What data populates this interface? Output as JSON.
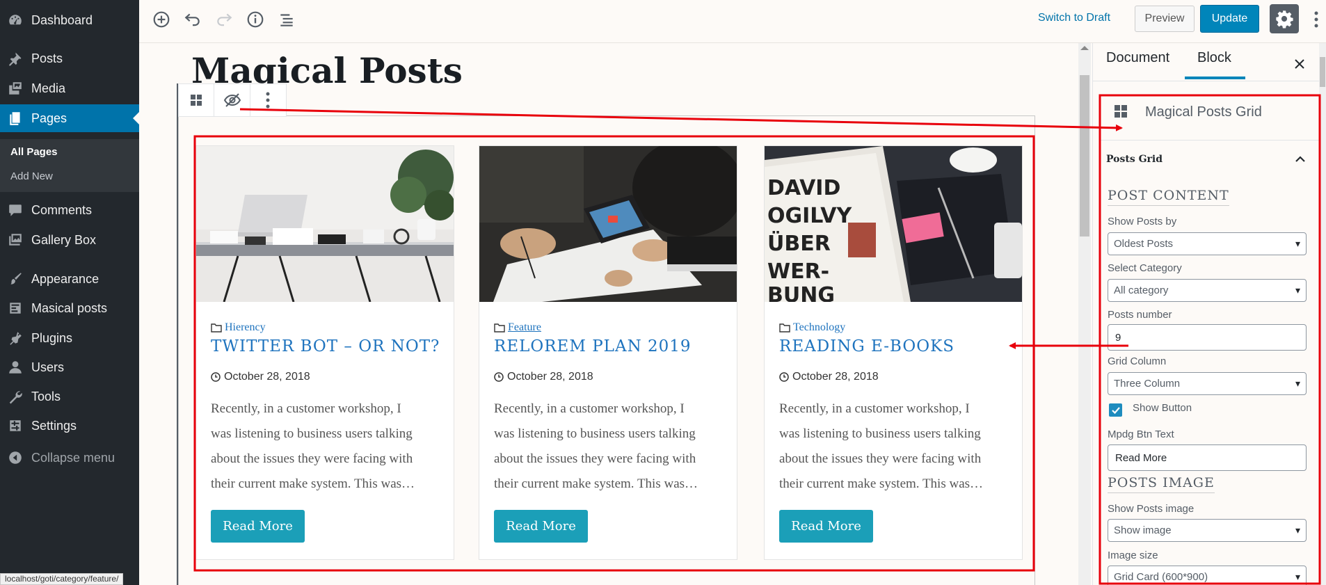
{
  "sidebar": {
    "items": [
      {
        "label": "Dashboard",
        "icon": "dashboard-icon"
      },
      {
        "label": "Posts",
        "icon": "pin-icon"
      },
      {
        "label": "Media",
        "icon": "media-icon"
      },
      {
        "label": "Pages",
        "icon": "pages-icon",
        "active": true
      },
      {
        "label": "Comments",
        "icon": "comment-icon"
      },
      {
        "label": "Gallery Box",
        "icon": "gallery-icon"
      },
      {
        "label": "Appearance",
        "icon": "brush-icon"
      },
      {
        "label": "Masical posts",
        "icon": "posts-icon"
      },
      {
        "label": "Plugins",
        "icon": "plugin-icon"
      },
      {
        "label": "Users",
        "icon": "user-icon"
      },
      {
        "label": "Tools",
        "icon": "wrench-icon"
      },
      {
        "label": "Settings",
        "icon": "settings-icon"
      }
    ],
    "submenu": {
      "all_pages": "All Pages",
      "add_new": "Add New"
    },
    "collapse_label": "Collapse menu"
  },
  "toolbar": {
    "switch_to_draft": "Switch to Draft",
    "preview_label": "Preview",
    "update_label": "Update"
  },
  "editor": {
    "page_title": "Magical Posts",
    "cards": [
      {
        "category": "Hierency",
        "title": "TWITTER BOT – OR NOT?",
        "date": "October 28, 2018",
        "excerpt": [
          "Recently, in a customer workshop, I",
          "was listening to business users talking",
          "about the issues they were facing with",
          "their current make system. This was…"
        ],
        "button": "Read More"
      },
      {
        "category": "Feature",
        "title": "RELOREM PLAN 2019",
        "date": "October 28, 2018",
        "excerpt": [
          "Recently, in a customer workshop, I",
          "was listening to business users talking",
          "about the issues they were facing with",
          "their current make system. This was…"
        ],
        "button": "Read More"
      },
      {
        "category": "Technology",
        "title": "READING E-BOOKS",
        "date": "October 28, 2018",
        "excerpt": [
          "Recently, in a customer workshop, I",
          "was listening to business users talking",
          "about the issues they were facing with",
          "their current make system. This was…"
        ],
        "button": "Read More"
      }
    ]
  },
  "panel": {
    "tabs": {
      "document": "Document",
      "block": "Block"
    },
    "block_name": "Magical Posts Grid",
    "section_title": "Posts Grid",
    "post_content_heading": "POST CONTENT",
    "show_posts_by": {
      "label": "Show Posts by",
      "value": "Oldest Posts"
    },
    "select_category": {
      "label": "Select Category",
      "value": "All category"
    },
    "posts_number": {
      "label": "Posts number",
      "value": "9"
    },
    "grid_column": {
      "label": "Grid Column",
      "value": "Three Column"
    },
    "show_button": {
      "label": "Show Button",
      "checked": true
    },
    "btn_text": {
      "label": "Mpdg Btn Text",
      "value": "Read More"
    },
    "posts_image_heading": "POSTS IMAGE",
    "show_posts_image": {
      "label": "Show Posts image",
      "value": "Show image"
    },
    "image_size": {
      "label": "Image size",
      "value": "Grid Card (600*900)"
    }
  },
  "status_url": "localhost/goti/category/feature/",
  "colors": {
    "admin_bg": "#23282d",
    "accent": "#0073aa",
    "update_button": "#0085ba",
    "read_more_button": "#1b9fb8",
    "title_blue": "#1e73be",
    "annotation_red": "#e8000b"
  }
}
